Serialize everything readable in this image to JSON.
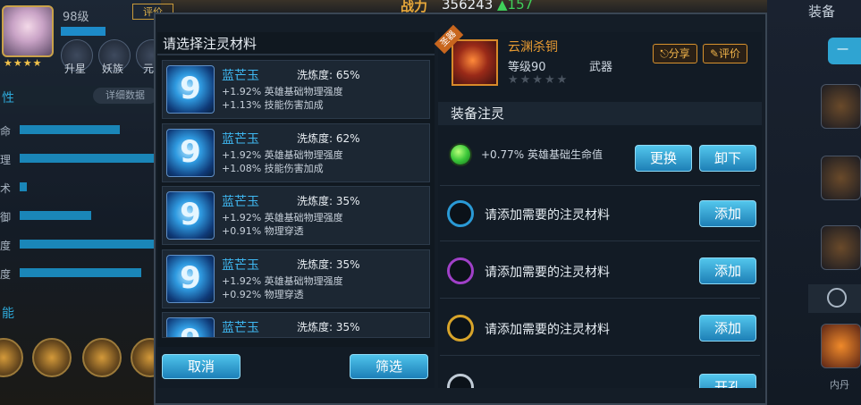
{
  "topbar": {
    "power_label": "战力",
    "power_value": "356243",
    "power_increase": "157"
  },
  "hero": {
    "level": "98级",
    "evaluate": "评价",
    "buttons": [
      {
        "label": "升星"
      },
      {
        "label": "妖族"
      },
      {
        "label": "元"
      }
    ],
    "attr_head": "性",
    "attr_detail": "详细数据",
    "attrs": [
      {
        "label": "命",
        "fill": 0.72
      },
      {
        "label": "理",
        "fill": 0.96
      },
      {
        "label": "术",
        "fill": 0.05
      },
      {
        "label": "御",
        "fill": 0.51
      },
      {
        "label": "度",
        "fill": 0.97
      },
      {
        "label": "度",
        "fill": 0.87
      }
    ],
    "skills_head": "能"
  },
  "right_side": {
    "title": "装备",
    "button_label": "一",
    "nd_label": "内丹"
  },
  "left_panel": {
    "title": "请选择注灵材料",
    "items": [
      {
        "icon": "9",
        "name": "蓝芒玉",
        "purity": "洗炼度: 65%",
        "stat1": "+1.92% 英雄基础物理强度",
        "stat2": "+1.13% 技能伤害加成"
      },
      {
        "icon": "9",
        "name": "蓝芒玉",
        "purity": "洗炼度: 62%",
        "stat1": "+1.92% 英雄基础物理强度",
        "stat2": "+1.08% 技能伤害加成"
      },
      {
        "icon": "9",
        "name": "蓝芒玉",
        "purity": "洗炼度: 35%",
        "stat1": "+1.92% 英雄基础物理强度",
        "stat2": "+0.91% 物理穿透"
      },
      {
        "icon": "9",
        "name": "蓝芒玉",
        "purity": "洗炼度: 35%",
        "stat1": "+1.92% 英雄基础物理强度",
        "stat2": "+0.92% 物理穿透"
      },
      {
        "icon": "9",
        "name": "蓝芒玉",
        "purity": "洗炼度: 35%",
        "stat1": "",
        "stat2": ""
      }
    ],
    "cancel_label": "取消",
    "filter_label": "筛选"
  },
  "weapon": {
    "tag": "圣器",
    "name": "云渊杀铜",
    "level": "等级90",
    "type": "武器",
    "stars": "★★★★★",
    "share_label": "分享",
    "evaluate_label": "评价"
  },
  "infuse": {
    "title": "装备注灵",
    "filled_slot": {
      "text": "+0.77% 英雄基础生命值",
      "replace_label": "更换",
      "unload_label": "卸下"
    },
    "empty_slots": [
      {
        "text": "请添加需要的注灵材料",
        "button": "添加",
        "ring_color": "#2a9ad6"
      },
      {
        "text": "请添加需要的注灵材料",
        "button": "添加",
        "ring_color": "#a040c8"
      },
      {
        "text": "请添加需要的注灵材料",
        "button": "添加",
        "ring_color": "#d8a42a"
      }
    ],
    "locked_button": "开孔"
  }
}
